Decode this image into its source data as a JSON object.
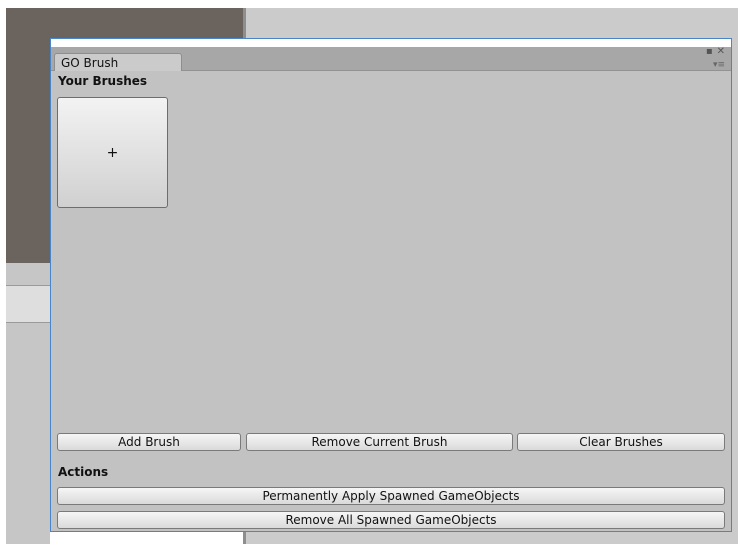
{
  "window": {
    "tab_title": "GO Brush",
    "restore_glyph": "▪",
    "close_glyph": "✕",
    "menu_glyph": "▾≡"
  },
  "brushes": {
    "section_title": "Your Brushes",
    "add_tile_glyph": "+"
  },
  "brush_buttons": {
    "add": "Add Brush",
    "remove_current": "Remove Current Brush",
    "clear": "Clear Brushes"
  },
  "actions": {
    "section_title": "Actions",
    "apply": "Permanently Apply Spawned GameObjects",
    "remove_all": "Remove All Spawned GameObjects"
  },
  "colors": {
    "window_bg": "#c2c2c2",
    "window_border": "#4a85c9",
    "scene_bg": "#6a635e"
  }
}
